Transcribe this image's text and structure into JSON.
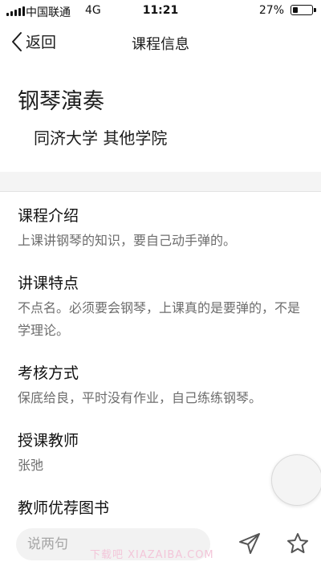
{
  "status_bar": {
    "carrier": "中国联通",
    "network": "4G",
    "time": "11:21",
    "battery_percent": "27%",
    "battery_level": 0.27
  },
  "nav": {
    "back_label": "返回",
    "title": "课程信息"
  },
  "course": {
    "title": "钢琴演奏",
    "school": "同济大学 其他学院"
  },
  "sections": [
    {
      "heading": "课程介绍",
      "body": "上课讲钢琴的知识，要自己动手弹的。"
    },
    {
      "heading": "讲课特点",
      "body": "不点名。必须要会钢琴，上课真的是要弹的，不是学理论。"
    },
    {
      "heading": "考核方式",
      "body": "保底给良，平时没有作业，自己练练钢琴。"
    },
    {
      "heading": "授课教师",
      "body": "张弛"
    },
    {
      "heading": "教师优荐图书",
      "body": ""
    }
  ],
  "bottom_bar": {
    "comment_placeholder": "说两句",
    "watermark": "下载吧 XIAZAIBA.COM"
  },
  "icons": {
    "back": "chevron-left-icon",
    "send": "paper-plane-icon",
    "favorite": "star-outline-icon"
  }
}
